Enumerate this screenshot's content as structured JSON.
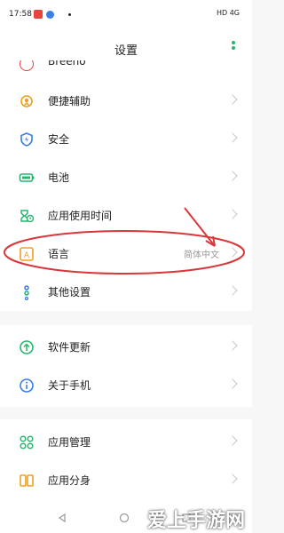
{
  "status_bar": {
    "time": "17:58",
    "dot": "•",
    "right_text": "HD  4G"
  },
  "header": {
    "title": "设置"
  },
  "partial_item": {
    "label": "Breeno"
  },
  "group1": [
    {
      "label": "便捷辅助",
      "icon": "hand-icon"
    },
    {
      "label": "安全",
      "icon": "shield-icon"
    },
    {
      "label": "电池",
      "icon": "battery-icon"
    },
    {
      "label": "应用使用时间",
      "icon": "hourglass-icon"
    },
    {
      "label": "语言",
      "icon": "language-icon",
      "value": "简体中文"
    },
    {
      "label": "其他设置",
      "icon": "more-settings-icon"
    }
  ],
  "group2": [
    {
      "label": "软件更新",
      "icon": "update-icon"
    },
    {
      "label": "关于手机",
      "icon": "info-icon"
    }
  ],
  "group3": [
    {
      "label": "应用管理",
      "icon": "apps-grid-icon"
    },
    {
      "label": "应用分身",
      "icon": "clone-icon"
    }
  ],
  "watermark": "爱上手游网",
  "colors": {
    "accent_green": "#2ab56f",
    "accent_blue": "#3a7ee8",
    "accent_orange": "#f0a020",
    "annotation_red": "#d9373a"
  }
}
